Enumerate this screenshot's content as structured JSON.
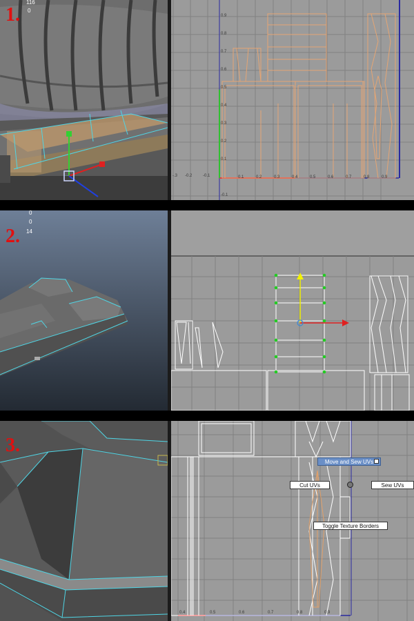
{
  "steps": [
    {
      "number": "1.",
      "hud_values": [
        "116",
        "0"
      ]
    },
    {
      "number": "2.",
      "hud_values": [
        "0",
        "0",
        "14"
      ]
    },
    {
      "number": "3.",
      "hud_values": []
    }
  ],
  "uv_editor": {
    "x_ticks": [
      "-.3",
      "-0.2",
      "-0.1",
      "0.1",
      "0.2",
      "0.3",
      "0.4",
      "0.5",
      "0.6",
      "0.7",
      "0.8",
      "0.9"
    ],
    "y_ticks": [
      "0.9",
      "0.8",
      "0.7",
      "0.6",
      "0.5",
      "0.4",
      "0.3",
      "0.2",
      "0.1",
      "-0.1"
    ],
    "panel3_ticks": [
      "0.4",
      "0.5",
      "0.6",
      "0.7",
      "0.8",
      "0.9"
    ]
  },
  "marking_menu": {
    "north": "Move and Sew UVs",
    "west": "Cut UVs",
    "east": "Sew UVs",
    "south": "Toggle Texture Borders"
  },
  "colors": {
    "uv_background": "#9b9b9b",
    "uv_grid": "#7e7e7e",
    "uv_shell_selected": "#e0a06a",
    "uv_shell": "#ffffff",
    "wire_cyan": "#4fd6e6",
    "step_label": "#e01010"
  },
  "icons": [
    "move-manipulator-icon",
    "radial-marking-menu-icon"
  ]
}
